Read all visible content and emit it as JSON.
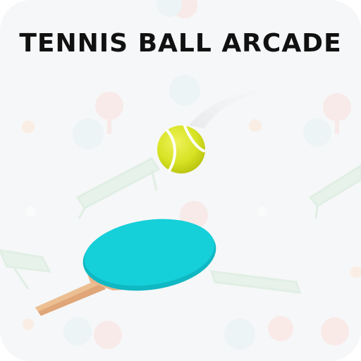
{
  "game": {
    "title": "TENNIS BALL ARCADE"
  },
  "colors": {
    "background": "#f6f7f8",
    "title": "#111111",
    "paddle_face": "#15cfd9",
    "paddle_handle": "#e0a678",
    "ball": "#d7e324",
    "pattern_paddle": "#fbe1db",
    "pattern_paddle_alt": "#e4f2f5",
    "pattern_table": "#dcefe0"
  },
  "icons": {
    "ball": "tennis-ball-icon",
    "paddle": "ping-pong-paddle-icon",
    "pattern": "ping-pong-doodle-pattern"
  }
}
